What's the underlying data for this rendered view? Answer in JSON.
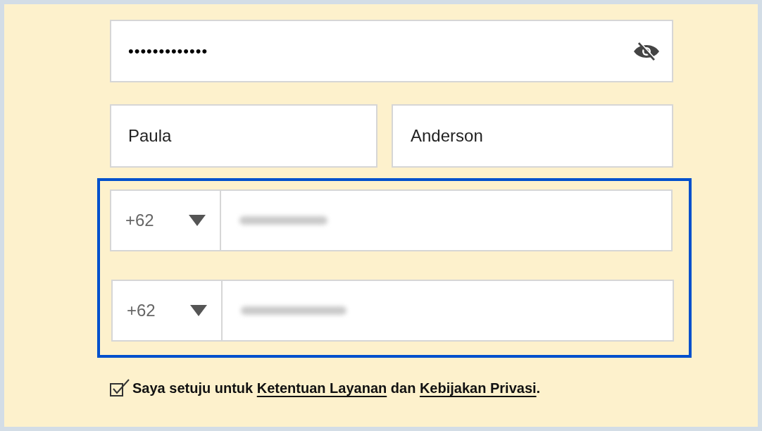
{
  "password": {
    "value": "•••••••••••••",
    "visible": false
  },
  "first_name": {
    "value": "Paula"
  },
  "last_name": {
    "value": "Anderson"
  },
  "phones": [
    {
      "country_code": "+62"
    },
    {
      "country_code": "+62"
    }
  ],
  "agreement": {
    "checked": true,
    "parts": [
      {
        "kind": "text",
        "text": "Saya setuju untuk "
      },
      {
        "kind": "link",
        "text": "Ketentuan Layanan"
      },
      {
        "kind": "text",
        "text": " dan "
      },
      {
        "kind": "link",
        "text": "Kebijakan Privasi"
      },
      {
        "kind": "text",
        "text": "."
      }
    ]
  }
}
